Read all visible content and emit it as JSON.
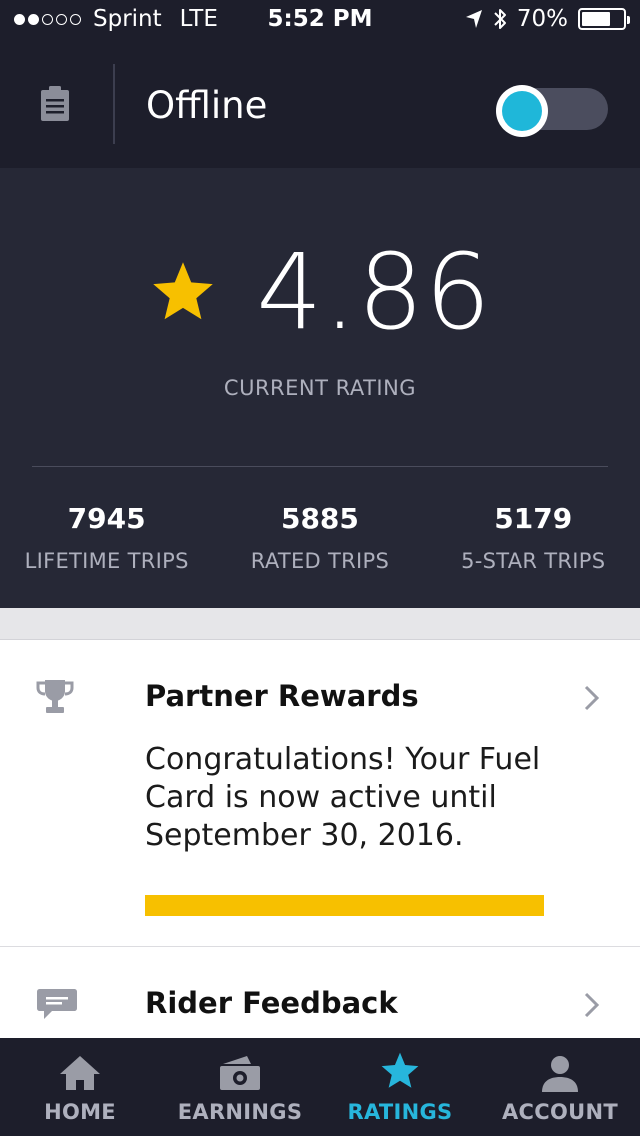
{
  "status_bar": {
    "carrier": "Sprint",
    "network": "LTE",
    "time": "5:52 PM",
    "battery": "70%",
    "battery_level": 0.7,
    "signal_bars_filled": 2,
    "signal_bars_total": 5,
    "icons": [
      "location-arrow-icon",
      "bluetooth-icon",
      "battery-icon"
    ]
  },
  "header": {
    "title": "Offline",
    "menu_icon": "clipboard-icon",
    "toggle_on": false,
    "toggle_color": "#1fb7d9"
  },
  "rating": {
    "value": "4.86",
    "caption": "CURRENT RATING",
    "star_color": "#f7c000",
    "stats": [
      {
        "value": "7945",
        "label": "LIFETIME TRIPS"
      },
      {
        "value": "5885",
        "label": "RATED TRIPS"
      },
      {
        "value": "5179",
        "label": "5-STAR TRIPS"
      }
    ]
  },
  "cards": {
    "rewards": {
      "icon": "trophy-icon",
      "title": "Partner Rewards",
      "body": "Congratulations! Your Fuel Card is now active until September 30, 2016.",
      "progress": 1.0,
      "progress_color": "#f7c000"
    },
    "feedback": {
      "icon": "chat-bubble-icon",
      "title": "Rider Feedback"
    }
  },
  "tabs": [
    {
      "label": "HOME",
      "icon": "home-icon",
      "active": false
    },
    {
      "label": "EARNINGS",
      "icon": "cash-icon",
      "active": false
    },
    {
      "label": "RATINGS",
      "icon": "star-icon",
      "active": true
    },
    {
      "label": "ACCOUNT",
      "icon": "person-icon",
      "active": false
    }
  ],
  "colors": {
    "header_bg": "#1d1e2b",
    "panel_bg": "#262836",
    "accent": "#27b6dc"
  }
}
